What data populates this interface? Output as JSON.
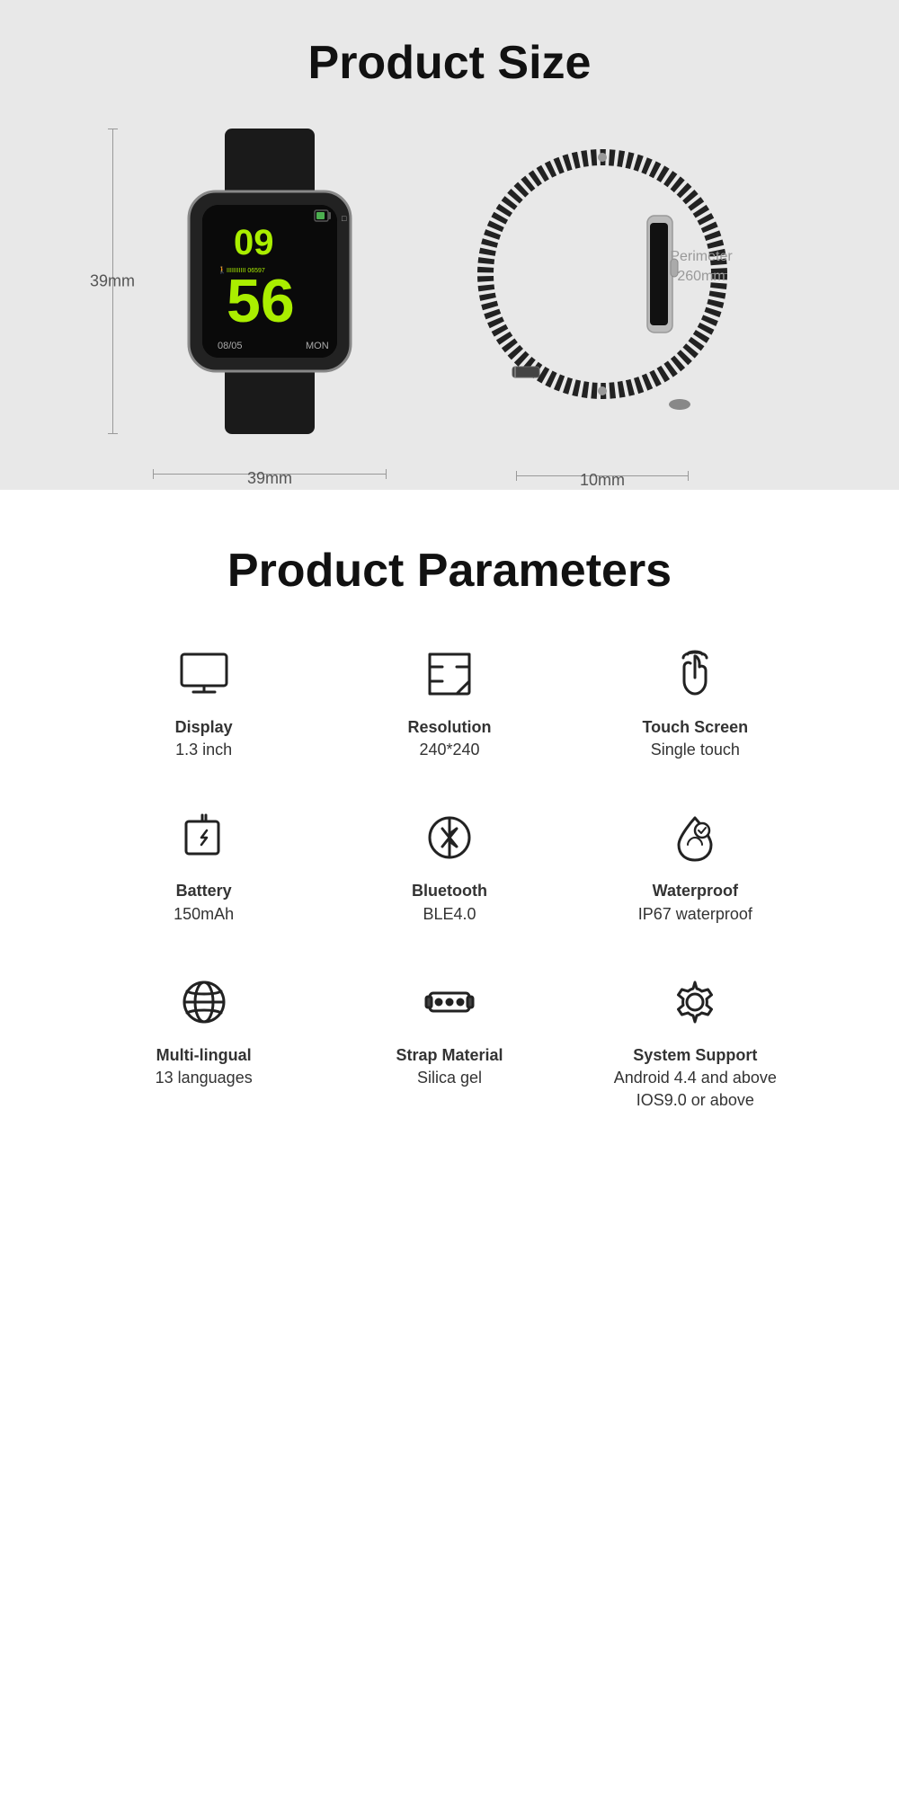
{
  "productSize": {
    "title": "Product Size",
    "frontWatch": {
      "dimWidth": "39mm",
      "dimHeight": "39mm"
    },
    "sideWatch": {
      "perimeter": "Perimeter\n260mm",
      "thickness": "10mm"
    }
  },
  "productParams": {
    "title": "Product Parameters",
    "items": [
      {
        "id": "display",
        "iconName": "monitor-icon",
        "label": "Display",
        "value": "1.3 inch"
      },
      {
        "id": "resolution",
        "iconName": "resolution-icon",
        "label": "Resolution",
        "value": "240*240"
      },
      {
        "id": "touch",
        "iconName": "touch-icon",
        "label": "Touch Screen",
        "value": "Single touch"
      },
      {
        "id": "battery",
        "iconName": "battery-icon",
        "label": "Battery",
        "value": "150mAh"
      },
      {
        "id": "bluetooth",
        "iconName": "bluetooth-icon",
        "label": "Bluetooth",
        "value": "BLE4.0"
      },
      {
        "id": "waterproof",
        "iconName": "waterproof-icon",
        "label": "Waterproof",
        "value": "IP67 waterproof"
      },
      {
        "id": "multilingual",
        "iconName": "globe-icon",
        "label": "Multi-lingual",
        "value": "13 languages"
      },
      {
        "id": "strap",
        "iconName": "strap-icon",
        "label": "Strap Material",
        "value": "Silica gel"
      },
      {
        "id": "system",
        "iconName": "system-icon",
        "label": "System Support",
        "value": "Android 4.4 and above\nIOS9.0 or above"
      }
    ]
  }
}
